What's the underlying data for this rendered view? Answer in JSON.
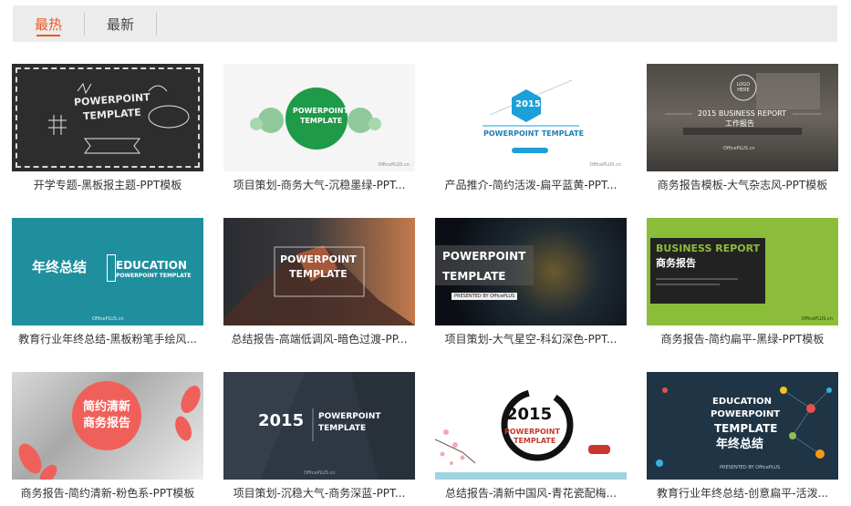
{
  "tabs": [
    {
      "label": "最热",
      "active": true
    },
    {
      "label": "最新",
      "active": false
    }
  ],
  "accent_color": "#e8592a",
  "templates": [
    {
      "caption": "开学专题-黑板报主题-PPT模板",
      "line1": "POWERPOINT",
      "line2": "TEMPLATE"
    },
    {
      "caption": "项目策划-商务大气-沉稳墨绿-PPT...",
      "line1": "POWERPOINT",
      "line2": "TEMPLATE",
      "footer": "OfficePLUS.cn"
    },
    {
      "caption": "产品推介-简约活泼-扁平蓝黄-PPT...",
      "year": "2015",
      "line1": "POWERPOINT TEMPLATE",
      "footer": "OfficePLUS.cn"
    },
    {
      "caption": "商务报告模板-大气杂志风-PPT模板",
      "logo": "LOGO HERE",
      "line1": "2015 BUSINESS REPORT",
      "line2": "工作报告",
      "footer": "OfficePLUS.cn"
    },
    {
      "caption": "教育行业年终总结-黑板粉笔手绘风...",
      "cn": "年终总结",
      "line1": "EDUCATION",
      "line2": "POWERPOINT TEMPLATE",
      "footer": "OfficePLUS.cn"
    },
    {
      "caption": "总结报告-高端低调风-暗色过渡-PP...",
      "line1": "POWERPOINT",
      "line2": "TEMPLATE"
    },
    {
      "caption": "项目策划-大气星空-科幻深色-PPT...",
      "line1": "POWERPOINT",
      "line2": "TEMPLATE",
      "badge": "PRESENTED BY OfficePLUS"
    },
    {
      "caption": "商务报告-简约扁平-黑绿-PPT模板",
      "line1": "BUSINESS REPORT",
      "line2": "商务报告",
      "footer": "OfficePLUS.cn"
    },
    {
      "caption": "商务报告-简约清新-粉色系-PPT模板",
      "line1": "简约清新",
      "line2": "商务报告"
    },
    {
      "caption": "项目策划-沉稳大气-商务深蓝-PPT...",
      "year": "2015",
      "line1": "POWERPOINT",
      "line2": "TEMPLATE",
      "footer": "OfficePLUS.cn"
    },
    {
      "caption": "总结报告-清新中国风-青花瓷配梅...",
      "year": "2015",
      "line1": "POWERPOINT",
      "line2": "TEMPLATE"
    },
    {
      "caption": "教育行业年终总结-创意扁平-活泼...",
      "line1": "EDUCATION",
      "line2": "POWERPOINT",
      "line3": "TEMPLATE",
      "cn": "年终总结",
      "footer": "PRESENTED BY OfficePLUS"
    }
  ]
}
